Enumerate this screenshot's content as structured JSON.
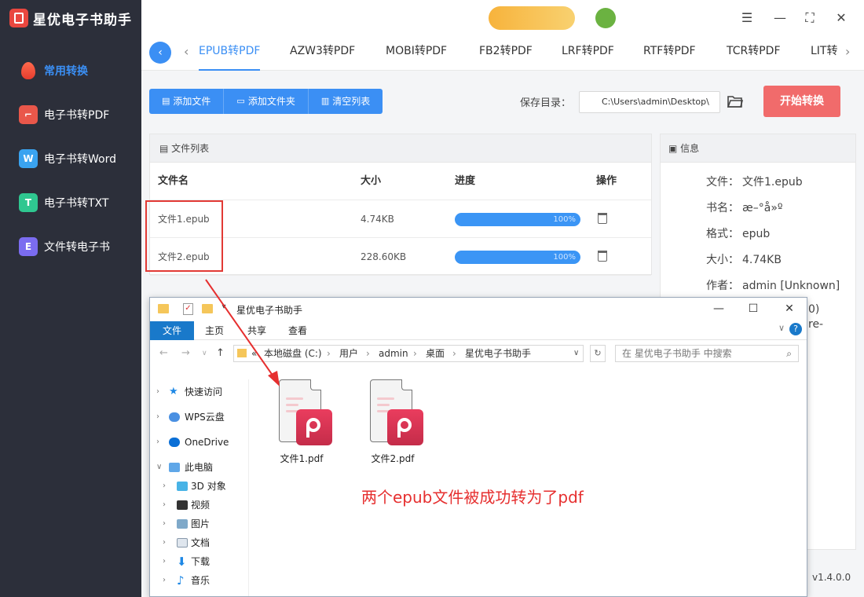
{
  "app": {
    "title": "星优电子书助手",
    "version": "v1.4.0.0"
  },
  "sidebar": {
    "items": [
      {
        "label": "常用转换",
        "icon": "flame-icon",
        "active": true
      },
      {
        "label": "电子书转PDF",
        "icon": "pdf-icon"
      },
      {
        "label": "电子书转Word",
        "icon": "word-icon",
        "glyph": "W"
      },
      {
        "label": "电子书转TXT",
        "icon": "txt-icon",
        "glyph": "T"
      },
      {
        "label": "文件转电子书",
        "icon": "ebook-icon",
        "glyph": "E"
      }
    ]
  },
  "tabs": [
    "EPUB转PDF",
    "AZW3转PDF",
    "MOBI转PDF",
    "FB2转PDF",
    "LRF转PDF",
    "RTF转PDF",
    "TCR转PDF",
    "LIT转"
  ],
  "toolbar": {
    "add_file": "添加文件",
    "add_folder": "添加文件夹",
    "clear_list": "清空列表",
    "save_label": "保存目录：",
    "save_path": "C:\\Users\\admin\\Desktop\\",
    "start": "开始转换"
  },
  "filelist": {
    "title": "文件列表",
    "columns": [
      "文件名",
      "大小",
      "进度",
      "操作"
    ],
    "rows": [
      {
        "name": "文件1.epub",
        "size": "4.74KB",
        "progress": "100%"
      },
      {
        "name": "文件2.epub",
        "size": "228.60KB",
        "progress": "100%"
      }
    ]
  },
  "info": {
    "title": "信息",
    "rows": [
      {
        "k": "文件：",
        "v": "文件1.epub"
      },
      {
        "k": "书名：",
        "v": "æ–°å»º"
      },
      {
        "k": "格式：",
        "v": "epub"
      },
      {
        "k": "大小：",
        "v": "4.74KB"
      },
      {
        "k": "作者：",
        "v": "admin [Unknown]"
      }
    ],
    "partial": [
      "0)",
      "re-"
    ]
  },
  "explorer": {
    "title": "星优电子书助手",
    "ribbon": [
      "文件",
      "主页",
      "共享",
      "查看"
    ],
    "breadcrumb": [
      "«",
      "本地磁盘 (C:)",
      "用户",
      "admin",
      "桌面",
      "星优电子书助手"
    ],
    "search_placeholder": "在 星优电子书助手 中搜索",
    "tree": [
      {
        "label": "快速访问",
        "icon": "star-icon"
      },
      {
        "label": "WPS云盘",
        "icon": "cloud-icon"
      },
      {
        "label": "OneDrive",
        "icon": "onedrive-icon"
      },
      {
        "label": "此电脑",
        "icon": "computer-icon"
      },
      {
        "label": "3D 对象",
        "icon": "cube-icon"
      },
      {
        "label": "视频",
        "icon": "video-icon"
      },
      {
        "label": "图片",
        "icon": "image-icon"
      },
      {
        "label": "文档",
        "icon": "document-icon"
      },
      {
        "label": "下载",
        "icon": "download-icon"
      },
      {
        "label": "音乐",
        "icon": "music-icon"
      }
    ],
    "files": [
      "文件1.pdf",
      "文件2.pdf"
    ]
  },
  "annotation": "两个epub文件被成功转为了pdf",
  "colors": {
    "accent": "#3b8ff4",
    "sidebar": "#2c2f3a",
    "start": "#f16b6b",
    "highlight": "#e23a35"
  }
}
